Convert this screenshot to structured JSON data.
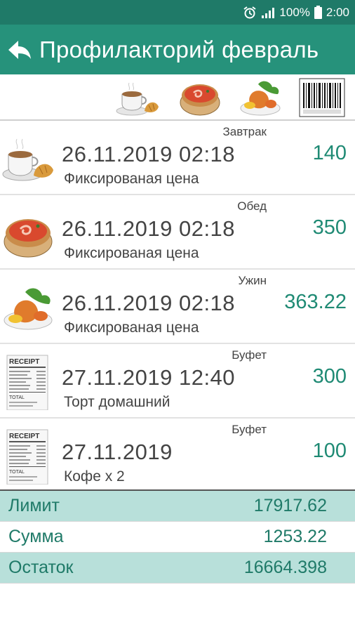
{
  "status_bar": {
    "battery_percent": "100%",
    "time": "2:00"
  },
  "header": {
    "title": "Профилакторий февраль"
  },
  "filters": [
    {
      "name": "breakfast-filter-icon"
    },
    {
      "name": "lunch-filter-icon"
    },
    {
      "name": "dinner-filter-icon"
    },
    {
      "name": "barcode-filter-icon"
    }
  ],
  "transactions": [
    {
      "category": "Завтрак",
      "datetime": "26.11.2019 02:18",
      "description": "Фиксированая цена",
      "amount": "140",
      "icon": "coffee-croissant-icon"
    },
    {
      "category": "Обед",
      "datetime": "26.11.2019 02:18",
      "description": "Фиксированая цена",
      "amount": "350",
      "icon": "soup-bowl-icon"
    },
    {
      "category": "Ужин",
      "datetime": "26.11.2019 02:18",
      "description": "Фиксированая цена",
      "amount": "363.22",
      "icon": "dinner-plate-icon"
    },
    {
      "category": "Буфет",
      "datetime": "27.11.2019 12:40",
      "description": "Торт домашний",
      "amount": "300",
      "icon": "receipt-icon"
    },
    {
      "category": "Буфет",
      "datetime": "27.11.2019",
      "description": "Кофе x 2",
      "amount": "100",
      "icon": "receipt-icon"
    }
  ],
  "receipt_label": "RECEIPT",
  "receipt_total_label": "TOTAL",
  "summary": {
    "limit": {
      "label": "Лимит",
      "value": "17917.62"
    },
    "sum": {
      "label": "Сумма",
      "value": "1253.22"
    },
    "balance": {
      "label": "Остаток",
      "value": "16664.398"
    }
  },
  "colors": {
    "status_bar": "#1f7a68",
    "app_bar": "#26927b",
    "amount": "#1f8a74",
    "summary_tint": "#b8e0da"
  }
}
